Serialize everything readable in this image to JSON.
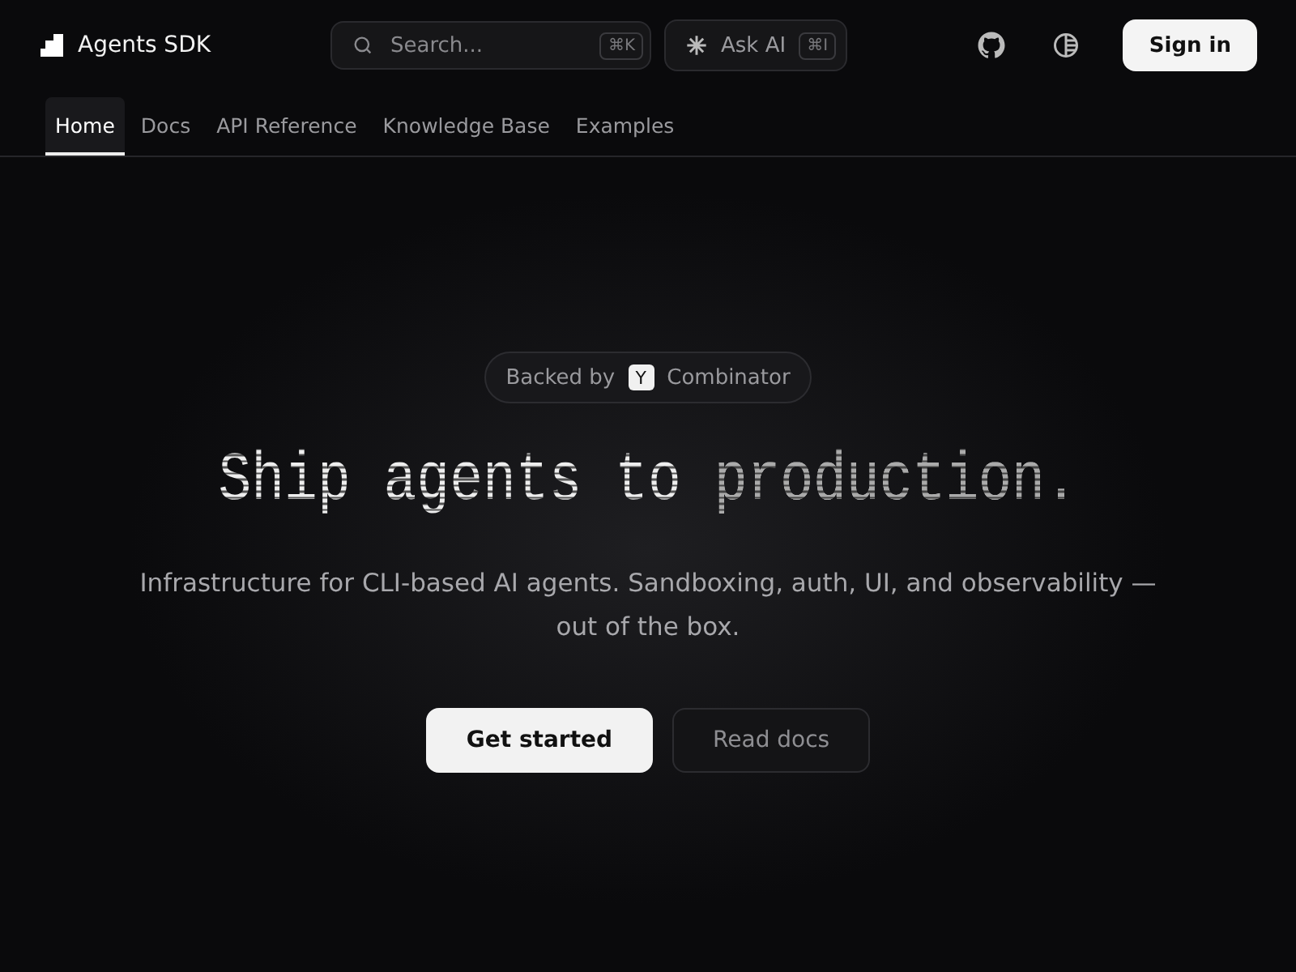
{
  "brand": {
    "name": "Agents SDK"
  },
  "search": {
    "placeholder": "Search...",
    "shortcut": "⌘K"
  },
  "ask_ai": {
    "label": "Ask AI",
    "shortcut": "⌘I"
  },
  "sign_in": "Sign in",
  "nav": [
    {
      "label": "Home",
      "selected": true
    },
    {
      "label": "Docs",
      "selected": false
    },
    {
      "label": "API Reference",
      "selected": false
    },
    {
      "label": "Knowledge Base",
      "selected": false
    },
    {
      "label": "Examples",
      "selected": false
    }
  ],
  "badge": {
    "before": "Backed by",
    "logo": "Y",
    "after": "Combinator"
  },
  "headline": "Ship agents to *production.*",
  "subtitle": "Infrastructure for CLI-based AI agents. Sandboxing, auth, UI, and observability — out of the box.",
  "buttons": [
    {
      "label": "Get started",
      "kind": "primary"
    },
    {
      "label": "Read docs",
      "kind": "secondary"
    }
  ]
}
